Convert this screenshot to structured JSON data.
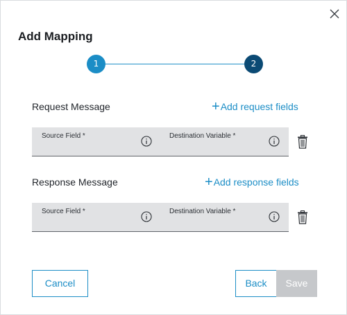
{
  "dialog": {
    "title": "Add Mapping",
    "close_icon": "close-icon"
  },
  "stepper": {
    "steps": [
      {
        "label": "1",
        "color": "#1b8dc6"
      },
      {
        "label": "2",
        "color": "#0b4a74"
      }
    ]
  },
  "request": {
    "label": "Request Message",
    "add_label": "Add request fields",
    "source_label": "Source Field *",
    "destination_label": "Destination Variable *"
  },
  "response": {
    "label": "Response Message",
    "add_label": "Add response fields",
    "source_label": "Source Field *",
    "destination_label": "Destination Variable *"
  },
  "footer": {
    "cancel_label": "Cancel",
    "back_label": "Back",
    "save_label": "Save"
  },
  "colors": {
    "accent": "#1b8dc6",
    "active_step": "#0b4a74",
    "field_bg": "#e1e2e4",
    "disabled": "#c6c8cb"
  }
}
